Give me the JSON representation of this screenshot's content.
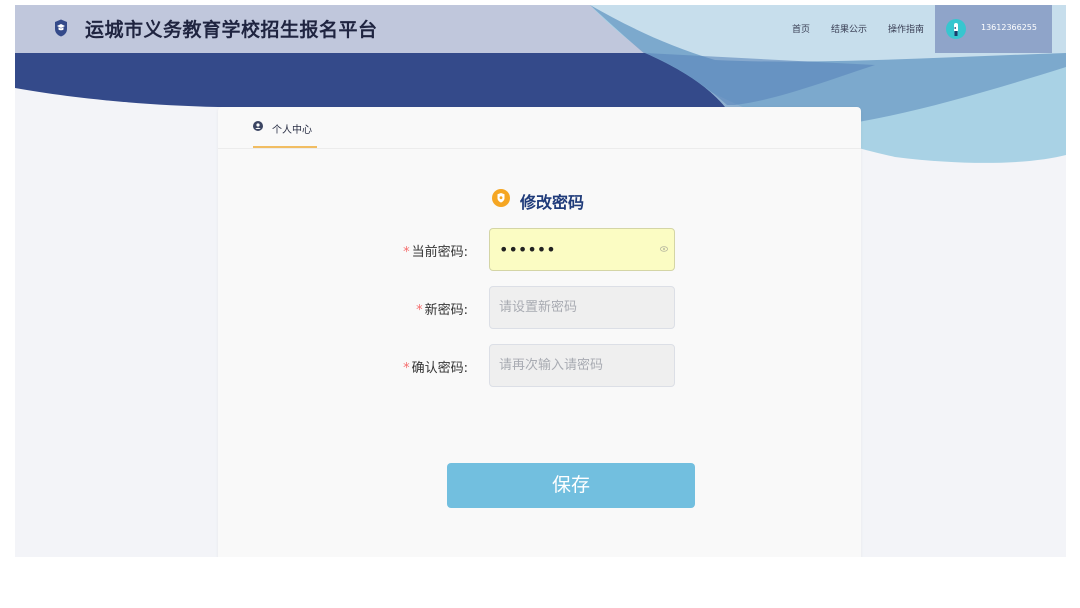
{
  "colors": {
    "header_bg": "#c0c7dc",
    "dark_wave": "#344a8a",
    "light_wave": "#a9d2e5",
    "accent_tab": "#f1bd62",
    "save_button": "#72bfdf",
    "required_star": "#f56c6c"
  },
  "header": {
    "logo_icon": "graduation-cap-icon",
    "title": "运城市义务教育学校招生报名平台",
    "nav": [
      "首页",
      "结果公示",
      "操作指南"
    ],
    "user": {
      "avatar_icon": "user-avatar-icon",
      "phone": "13612366255"
    }
  },
  "tabs": [
    {
      "icon": "user-circle-icon",
      "label": "个人中心"
    }
  ],
  "form": {
    "title_icon": "shield-icon",
    "title": "修改密码",
    "required_mark": "*",
    "fields": [
      {
        "label": "当前密码:",
        "value": "••••••",
        "placeholder": ""
      },
      {
        "label": "新密码:",
        "value": "",
        "placeholder": "请设置新密码"
      },
      {
        "label": "确认密码:",
        "value": "",
        "placeholder": "请再次输入请密码"
      }
    ],
    "save_label": "保存"
  }
}
